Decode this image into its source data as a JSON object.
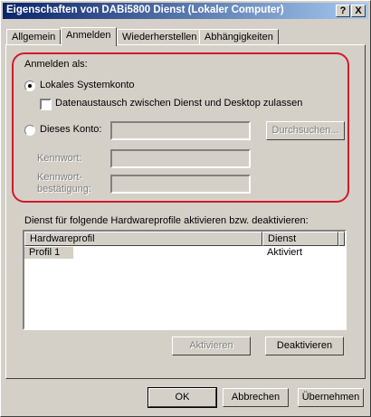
{
  "window": {
    "title": "Eigenschaften von DABi5800 Dienst (Lokaler Computer)",
    "help_button": "?",
    "close_button": "X"
  },
  "tabs": [
    {
      "label": "Allgemein",
      "active": false
    },
    {
      "label": "Anmelden",
      "active": true
    },
    {
      "label": "Wiederherstellen",
      "active": false
    },
    {
      "label": "Abhängigkeiten",
      "active": false
    }
  ],
  "logon": {
    "heading": "Anmelden als:",
    "local_system_label": "Lokales Systemkonto",
    "local_system_selected": true,
    "desktop_interact_label": "Datenaustausch zwischen Dienst und Desktop zulassen",
    "desktop_interact_checked": false,
    "this_account_label": "Dieses Konto:",
    "this_account_value": "",
    "browse_label": "Durchsuchen...",
    "password_label": "Kennwort:",
    "password_value": "",
    "confirm_label_line1": "Kennwort-",
    "confirm_label_line2": "bestätigung:",
    "confirm_value": ""
  },
  "highlight_color": "#d21a2c",
  "profiles": {
    "caption": "Dienst für folgende Hardwareprofile aktivieren bzw. deaktivieren:",
    "columns": [
      "Hardwareprofil",
      "Dienst"
    ],
    "rows": [
      {
        "profile": "Profil 1",
        "service": "Aktiviert"
      }
    ],
    "enable_label": "Aktivieren",
    "disable_label": "Deaktivieren"
  },
  "footer": {
    "ok_label": "OK",
    "cancel_label": "Abbrechen",
    "apply_label": "Übernehmen"
  }
}
